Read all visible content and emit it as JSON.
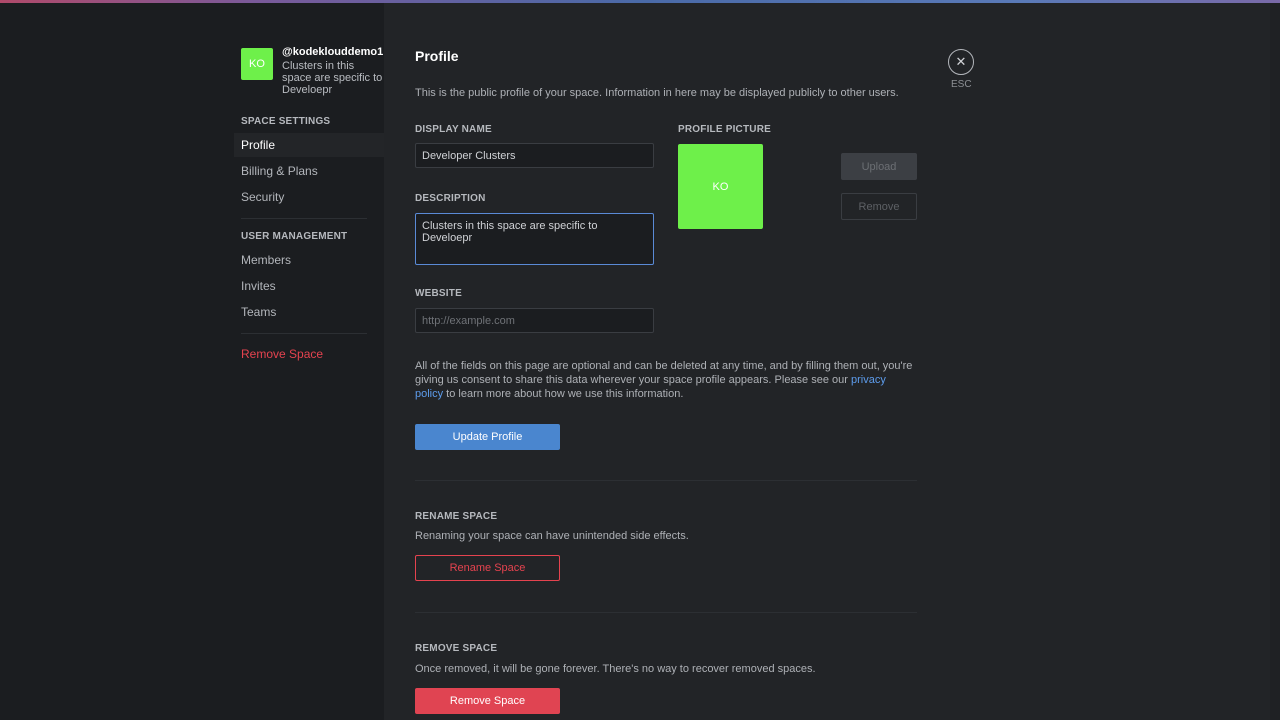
{
  "colors": {
    "accent": "#4a86cf",
    "danger": "#e04452",
    "avatar_green": "#6ef04a",
    "link": "#5d9cec"
  },
  "space": {
    "avatar_initials": "KO",
    "handle": "@kodeklouddemo1",
    "description": "Clusters in this space are specific to Develoepr"
  },
  "sidebar": {
    "space_settings_header": "SPACE SETTINGS",
    "settings_items": [
      {
        "label": "Profile",
        "active": true
      },
      {
        "label": "Billing & Plans",
        "active": false
      },
      {
        "label": "Security",
        "active": false
      }
    ],
    "user_management_header": "USER MANAGEMENT",
    "user_items": [
      {
        "label": "Members"
      },
      {
        "label": "Invites"
      },
      {
        "label": "Teams"
      }
    ],
    "remove_space_label": "Remove Space"
  },
  "main": {
    "title": "Profile",
    "subtitle": "This is the public profile of your space. Information in here may be displayed publicly to other users.",
    "close_icon": "close-icon",
    "esc_label": "ESC",
    "display_name": {
      "label": "DISPLAY NAME",
      "value": "Developer Clusters"
    },
    "description": {
      "label": "DESCRIPTION",
      "value": "Clusters in this space are specific to Develoepr"
    },
    "website": {
      "label": "WEBSITE",
      "value": "",
      "placeholder": "http://example.com"
    },
    "profile_picture": {
      "label": "PROFILE PICTURE",
      "initials": "KO",
      "upload_label": "Upload",
      "remove_label": "Remove"
    },
    "consent_text_before": "All of the fields on this page are optional and can be deleted at any time, and by filling them out, you're giving us consent to share this data wherever your space profile appears. Please see our ",
    "consent_link": "privacy policy",
    "consent_text_after": " to learn more about how we use this information.",
    "update_button": "Update Profile",
    "rename_section": {
      "title": "RENAME SPACE",
      "text": "Renaming your space can have unintended side effects.",
      "button": "Rename Space"
    },
    "remove_section": {
      "title": "REMOVE SPACE",
      "text": "Once removed, it will be gone forever. There's no way to recover removed spaces.",
      "button": "Remove Space"
    }
  }
}
